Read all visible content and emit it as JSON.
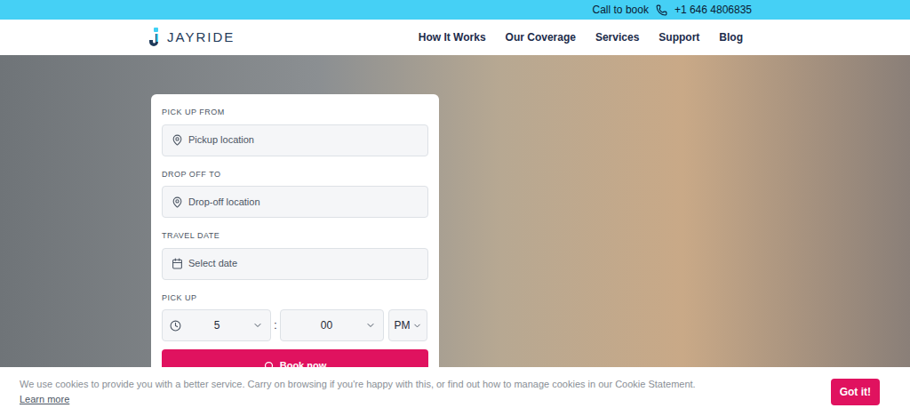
{
  "topbar": {
    "text": "Call to book",
    "phone": "+1 646 4806835"
  },
  "logo": "JAYRIDE",
  "nav": [
    "How It Works",
    "Our Coverage",
    "Services",
    "Support",
    "Blog"
  ],
  "form": {
    "fields": [
      {
        "label": "PICK UP FROM",
        "placeholder": "Pickup location",
        "kind": "location"
      },
      {
        "label": "DROP OFF TO",
        "placeholder": "Drop-off location",
        "kind": "location"
      },
      {
        "label": "TRAVEL DATE",
        "placeholder": "Select date",
        "kind": "date"
      }
    ],
    "time": {
      "label": "PICK UP",
      "hour": "5",
      "separator": ":",
      "minute": "00",
      "period": "PM"
    },
    "button": "Book now"
  },
  "cookie": {
    "text": "We use cookies to provide you with a better service. Carry on browsing if you're happy with this, or find out how to manage cookies in our Cookie Statement.",
    "link": "Learn more",
    "button": "Got it!"
  }
}
